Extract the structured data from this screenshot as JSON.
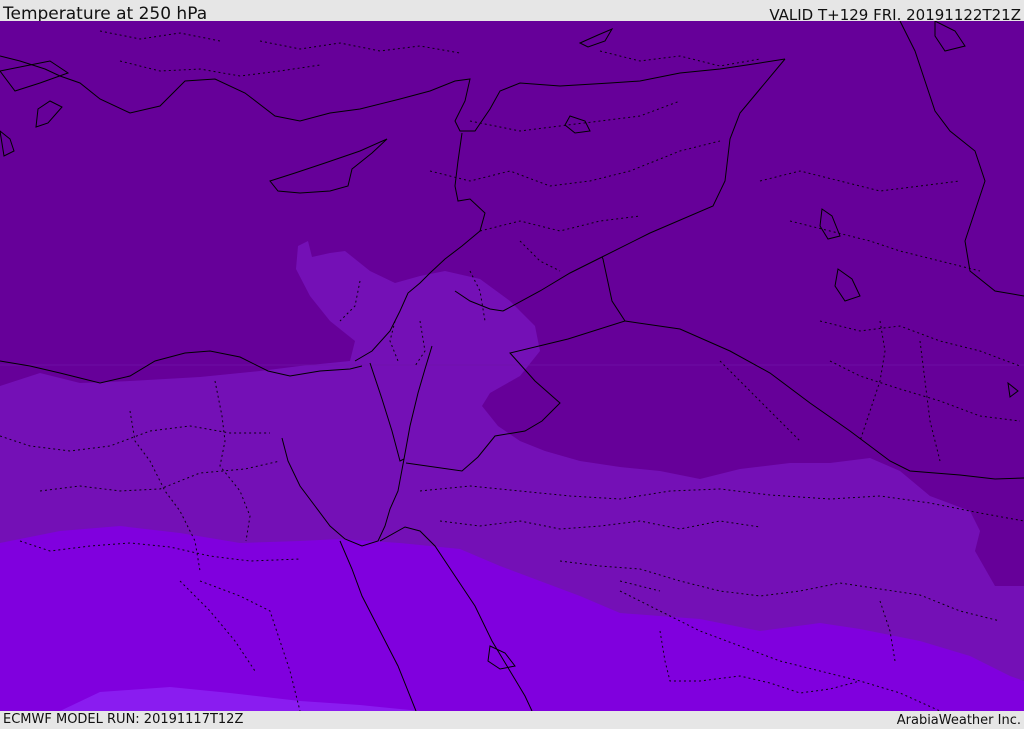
{
  "header": {
    "title": "Temperature at 250 hPa",
    "valid": "VALID T+129 FRI. 20191122T21Z"
  },
  "footer": {
    "model_run": "ECMWF MODEL RUN: 20191117T12Z",
    "credit": "ArabiaWeather Inc."
  },
  "colors": {
    "band_dark": "#660099",
    "band_mid": "#7410b6",
    "band_light": "#8000de",
    "band_lightest": "#8a1cf0",
    "outline": "#000000"
  }
}
